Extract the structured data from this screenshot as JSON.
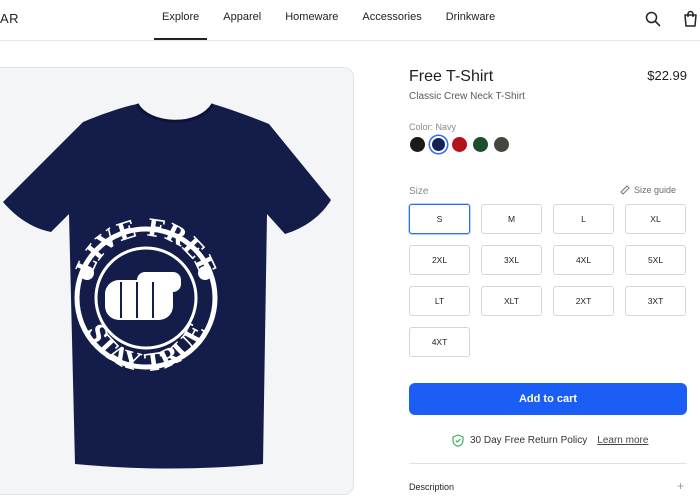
{
  "header": {
    "logo_text": "AR",
    "nav": [
      "Explore",
      "Apparel",
      "Homeware",
      "Accessories",
      "Drinkware"
    ],
    "icons": [
      "search-icon",
      "cart-icon"
    ]
  },
  "product": {
    "title": "Free T-Shirt",
    "price": "$22.99",
    "subtitle": "Classic Crew Neck T-Shirt",
    "image_text_top": "LIVE FREE",
    "image_text_bottom": "STAY TRUE",
    "shirt_color": "#141d4a"
  },
  "color": {
    "label": "Color: Navy",
    "swatches": [
      {
        "name": "Black",
        "hex": "#1a1a1a"
      },
      {
        "name": "Navy",
        "hex": "#15225a",
        "selected": true
      },
      {
        "name": "Red",
        "hex": "#b5121b"
      },
      {
        "name": "Green",
        "hex": "#1e4d2b"
      },
      {
        "name": "Olive",
        "hex": "#45463e"
      }
    ]
  },
  "size": {
    "label": "Size",
    "guide_label": "Size guide",
    "options": [
      "S",
      "M",
      "L",
      "XL",
      "2XL",
      "3XL",
      "4XL",
      "5XL",
      "LT",
      "XLT",
      "2XT",
      "3XT",
      "4XT"
    ],
    "selected": "S"
  },
  "cart": {
    "label": "Add to cart",
    "color": "#1b5ef5"
  },
  "returns": {
    "text": "30 Day Free Return Policy",
    "link": "Learn more"
  },
  "description": {
    "label": "Description",
    "toggle": "+"
  }
}
